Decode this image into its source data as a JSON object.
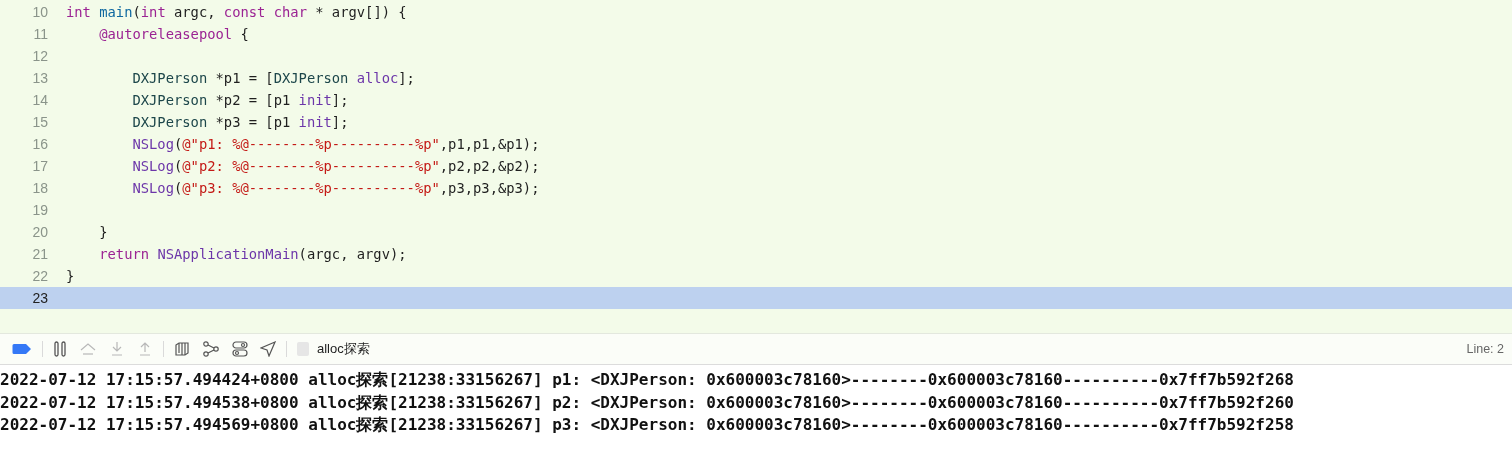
{
  "editor": {
    "lines": [
      {
        "number": "10",
        "selected": false,
        "tokens": [
          {
            "kind": "keyword",
            "text": "int"
          },
          {
            "kind": "function",
            "text": " main"
          },
          {
            "kind": "plain",
            "text": "("
          },
          {
            "kind": "keyword",
            "text": "int"
          },
          {
            "kind": "plain",
            "text": " argc, "
          },
          {
            "kind": "keyword",
            "text": "const"
          },
          {
            "kind": "keyword",
            "text": " char"
          },
          {
            "kind": "plain",
            "text": " * argv[]) {"
          }
        ]
      },
      {
        "number": "11",
        "selected": false,
        "tokens": [
          {
            "kind": "keyword",
            "text": "    @autoreleasepool"
          },
          {
            "kind": "plain",
            "text": " {"
          }
        ]
      },
      {
        "number": "12",
        "selected": false
      },
      {
        "number": "13",
        "selected": false,
        "tokens": [
          {
            "kind": "type",
            "text": "        DXJPerson"
          },
          {
            "kind": "plain",
            "text": " *p1 = ["
          },
          {
            "kind": "type",
            "text": "DXJPerson"
          },
          {
            "kind": "method",
            "text": " alloc"
          },
          {
            "kind": "plain",
            "text": "];"
          }
        ]
      },
      {
        "number": "14",
        "selected": false,
        "tokens": [
          {
            "kind": "type",
            "text": "        DXJPerson"
          },
          {
            "kind": "plain",
            "text": " *p2 = [p1 "
          },
          {
            "kind": "method",
            "text": "init"
          },
          {
            "kind": "plain",
            "text": "];"
          }
        ]
      },
      {
        "number": "15",
        "selected": false,
        "tokens": [
          {
            "kind": "type",
            "text": "        DXJPerson"
          },
          {
            "kind": "plain",
            "text": " *p3 = [p1 "
          },
          {
            "kind": "method",
            "text": "init"
          },
          {
            "kind": "plain",
            "text": "];"
          }
        ]
      },
      {
        "number": "16",
        "selected": false,
        "tokens": [
          {
            "kind": "method",
            "text": "        NSLog"
          },
          {
            "kind": "plain",
            "text": "("
          },
          {
            "kind": "string",
            "text": "@\"p1: %@--------%p----------%p\""
          },
          {
            "kind": "plain",
            "text": ",p1,p1,&p1);"
          }
        ]
      },
      {
        "number": "17",
        "selected": false,
        "tokens": [
          {
            "kind": "method",
            "text": "        NSLog"
          },
          {
            "kind": "plain",
            "text": "("
          },
          {
            "kind": "string",
            "text": "@\"p2: %@--------%p----------%p\""
          },
          {
            "kind": "plain",
            "text": ",p2,p2,&p2);"
          }
        ]
      },
      {
        "number": "18",
        "selected": false,
        "tokens": [
          {
            "kind": "method",
            "text": "        NSLog"
          },
          {
            "kind": "plain",
            "text": "("
          },
          {
            "kind": "string",
            "text": "@\"p3: %@--------%p----------%p\""
          },
          {
            "kind": "plain",
            "text": ",p3,p3,&p3);"
          }
        ]
      },
      {
        "number": "19",
        "selected": false
      },
      {
        "number": "20",
        "selected": false,
        "tokens": [
          {
            "kind": "plain",
            "text": "    }"
          }
        ]
      },
      {
        "number": "21",
        "selected": false,
        "tokens": [
          {
            "kind": "keyword",
            "text": "    return"
          },
          {
            "kind": "method",
            "text": " NSApplicationMain"
          },
          {
            "kind": "plain",
            "text": "(argc, argv);"
          }
        ]
      },
      {
        "number": "22",
        "selected": false,
        "tokens": [
          {
            "kind": "plain",
            "text": "}"
          }
        ]
      },
      {
        "number": "23",
        "selected": true
      }
    ]
  },
  "debug_bar": {
    "buttons": [
      {
        "kind": "breakpoints",
        "disabled": false
      },
      {
        "kind": "pause",
        "disabled": false
      },
      {
        "kind": "step_over",
        "disabled": true
      },
      {
        "kind": "step_into",
        "disabled": true
      },
      {
        "kind": "step_out",
        "disabled": true
      },
      {
        "kind": "view_hierarchy",
        "disabled": false
      },
      {
        "kind": "memory_graph",
        "disabled": false
      },
      {
        "kind": "environment",
        "disabled": false
      },
      {
        "kind": "location",
        "disabled": false
      }
    ],
    "process": "alloc探索",
    "line_indicator": "Line: 2"
  },
  "console": {
    "lines": [
      "2022-07-12 17:15:57.494424+0800 alloc探索[21238:33156267] p1: <DXJPerson: 0x600003c78160>--------0x600003c78160----------0x7ff7b592f268",
      "2022-07-12 17:15:57.494538+0800 alloc探索[21238:33156267] p2: <DXJPerson: 0x600003c78160>--------0x600003c78160----------0x7ff7b592f260",
      "2022-07-12 17:15:57.494569+0800 alloc探索[21238:33156267] p3: <DXJPerson: 0x600003c78160>--------0x600003c78160----------0x7ff7b592f258"
    ]
  }
}
